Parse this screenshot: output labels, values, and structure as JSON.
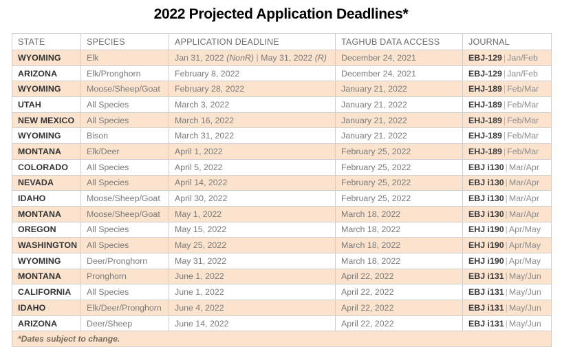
{
  "title": "2022 Projected Application Deadlines*",
  "table": {
    "columns": [
      "STATE",
      "SPECIES",
      "APPLICATION DEADLINE",
      "TAGHUB DATA ACCESS",
      "JOURNAL"
    ],
    "rows": [
      {
        "state": "WYOMING",
        "species": "Elk",
        "deadline_parts": [
          {
            "text": "Jan 31, 2022 ",
            "style": "normal"
          },
          {
            "text": "(NonR)",
            "style": "italic"
          },
          {
            "text": " | ",
            "style": "bar"
          },
          {
            "text": "May 31, 2022 ",
            "style": "normal"
          },
          {
            "text": "(R)",
            "style": "italic"
          }
        ],
        "deadline": "Jan 31, 2022 (NonR) | May 31, 2022 (R)",
        "taghub": "December 24, 2021",
        "journal_code": "EBJ-129",
        "journal_issue": "Jan/Feb",
        "tint": true
      },
      {
        "state": "ARIZONA",
        "species": "Elk/Pronghorn",
        "deadline": "February 8, 2022",
        "taghub": "December 24, 2021",
        "journal_code": "EBJ-129",
        "journal_issue": "Jan/Feb",
        "tint": false
      },
      {
        "state": "WYOMING",
        "species": "Moose/Sheep/Goat",
        "deadline": "February 28, 2022",
        "taghub": "January 21, 2022",
        "journal_code": "EHJ-189",
        "journal_issue": "Feb/Mar",
        "tint": true
      },
      {
        "state": "UTAH",
        "species": "All Species",
        "deadline": "March 3, 2022",
        "taghub": "January 21, 2022",
        "journal_code": "EHJ-189",
        "journal_issue": "Feb/Mar",
        "tint": false
      },
      {
        "state": "NEW MEXICO",
        "species": "All Species",
        "deadline": "March 16, 2022",
        "taghub": "January 21, 2022",
        "journal_code": "EHJ-189",
        "journal_issue": "Feb/Mar",
        "tint": true
      },
      {
        "state": "WYOMING",
        "species": "Bison",
        "deadline": "March 31, 2022",
        "taghub": "January 21, 2022",
        "journal_code": "EHJ-189",
        "journal_issue": "Feb/Mar",
        "tint": false
      },
      {
        "state": "MONTANA",
        "species": "Elk/Deer",
        "deadline": "April 1, 2022",
        "taghub": "February 25, 2022",
        "journal_code": "EHJ-189",
        "journal_issue": "Feb/Mar",
        "tint": true
      },
      {
        "state": "COLORADO",
        "species": "All Species",
        "deadline": "April 5, 2022",
        "taghub": "February 25, 2022",
        "journal_code": "EBJ i130",
        "journal_issue": "Mar/Apr",
        "tint": false
      },
      {
        "state": "NEVADA",
        "species": "All Species",
        "deadline": "April 14, 2022",
        "taghub": "February 25, 2022",
        "journal_code": "EBJ i130",
        "journal_issue": "Mar/Apr",
        "tint": true
      },
      {
        "state": "IDAHO",
        "species": "Moose/Sheep/Goat",
        "deadline": "April 30, 2022",
        "taghub": "February 25, 2022",
        "journal_code": "EBJ i130",
        "journal_issue": "Mar/Apr",
        "tint": false
      },
      {
        "state": "MONTANA",
        "species": "Moose/Sheep/Goat",
        "deadline": "May 1, 2022",
        "taghub": "March 18, 2022",
        "journal_code": "EBJ i130",
        "journal_issue": "Mar/Apr",
        "tint": true
      },
      {
        "state": "OREGON",
        "species": "All Species",
        "deadline": "May 15, 2022",
        "taghub": "March 18, 2022",
        "journal_code": "EHJ i190",
        "journal_issue": "Apr/May",
        "tint": false
      },
      {
        "state": "WASHINGTON",
        "species": "All Species",
        "deadline": "May 25, 2022",
        "taghub": "March 18, 2022",
        "journal_code": "EHJ i190",
        "journal_issue": "Apr/May",
        "tint": true
      },
      {
        "state": "WYOMING",
        "species": "Deer/Pronghorn",
        "deadline": "May 31, 2022",
        "taghub": "March 18, 2022",
        "journal_code": "EHJ i190",
        "journal_issue": "Apr/May",
        "tint": false
      },
      {
        "state": "MONTANA",
        "species": "Pronghorn",
        "deadline": "June 1, 2022",
        "taghub": "April 22, 2022",
        "journal_code": "EBJ i131",
        "journal_issue": "May/Jun",
        "tint": true
      },
      {
        "state": "CALIFORNIA",
        "species": "All Species",
        "deadline": "June 1, 2022",
        "taghub": "April 22, 2022",
        "journal_code": "EBJ i131",
        "journal_issue": "May/Jun",
        "tint": false
      },
      {
        "state": "IDAHO",
        "species": "Elk/Deer/Pronghorn",
        "deadline": "June 4, 2022",
        "taghub": "April 22, 2022",
        "journal_code": "EBJ i131",
        "journal_issue": "May/Jun",
        "tint": true
      },
      {
        "state": "ARIZONA",
        "species": "Deer/Sheep",
        "deadline": "June 14, 2022",
        "taghub": "April 22, 2022",
        "journal_code": "EBJ i131",
        "journal_issue": "May/Jun",
        "tint": false
      }
    ],
    "footnote": "*Dates subject to change."
  },
  "colors": {
    "tint_row": "#fbe3ce",
    "border": "#cfcfcf",
    "header_text": "#6f6f6f",
    "body_text": "#7a7a7a",
    "state_text": "#333333",
    "title_text": "#000000"
  }
}
